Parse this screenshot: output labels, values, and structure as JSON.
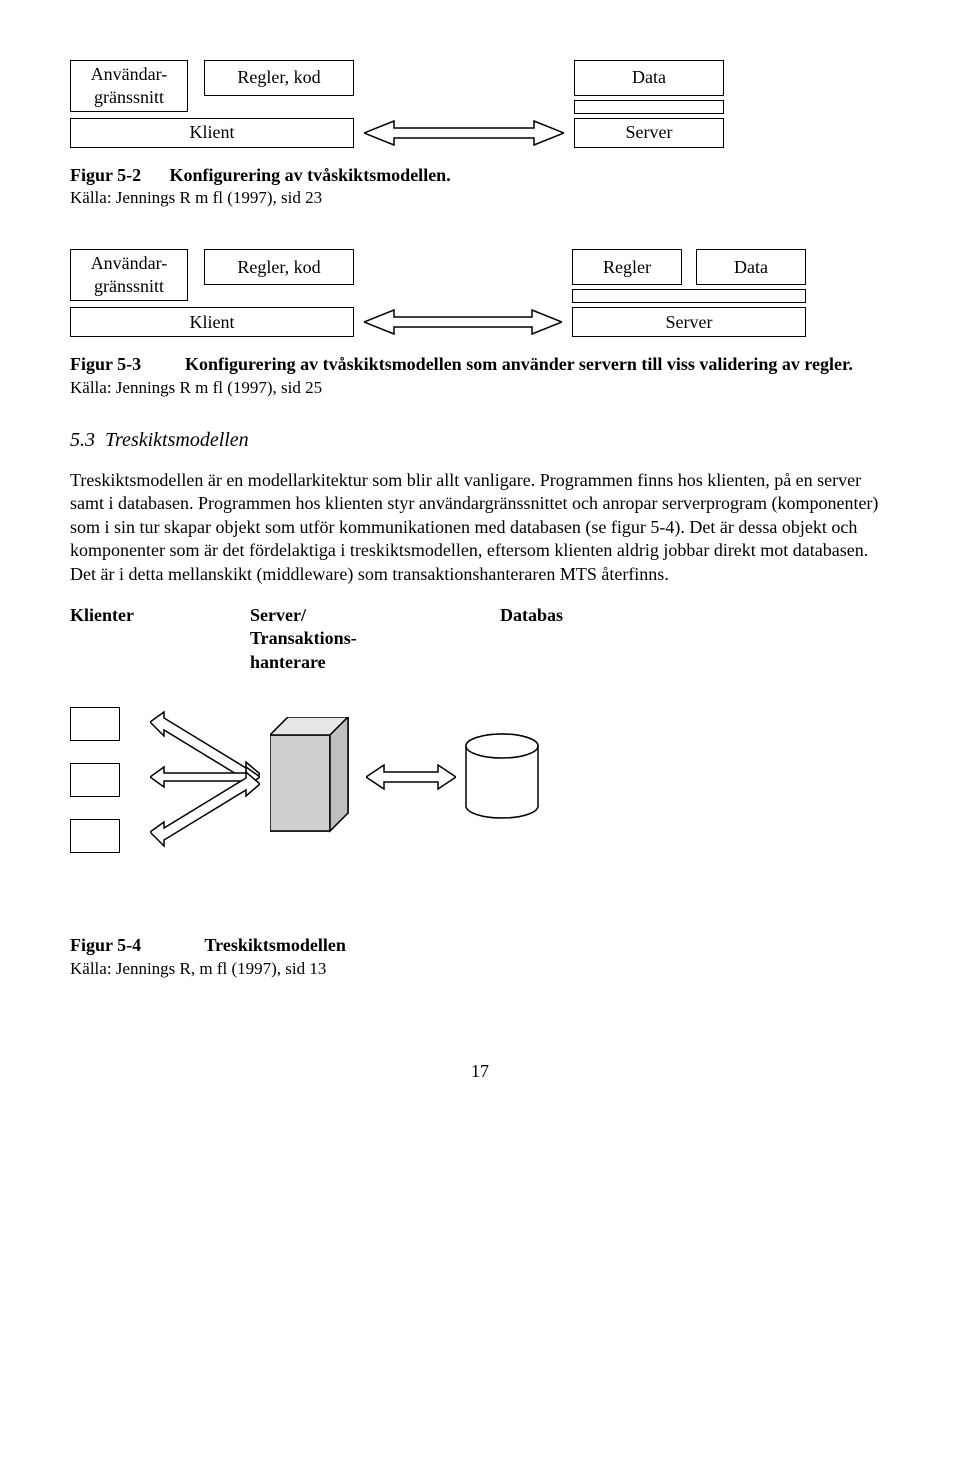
{
  "fig52": {
    "box_anvandar": "Användar-\ngränssnitt",
    "box_regler": "Regler, kod",
    "box_data": "Data",
    "box_klient": "Klient",
    "box_server": "Server",
    "label": "Figur 5-2",
    "title": "Konfigurering av tvåskiktsmodellen.",
    "source": "Källa: Jennings R m fl (1997), sid 23"
  },
  "fig53": {
    "box_anvandar": "Användar-\ngränssnitt",
    "box_reglerkod": "Regler, kod",
    "box_regler": "Regler",
    "box_data": "Data",
    "box_klient": "Klient",
    "box_server": "Server",
    "label": "Figur 5-3",
    "title": "Konfigurering av tvåskiktsmodellen som använder servern till viss validering av regler.",
    "source": "Källa: Jennings R m fl (1997), sid 25"
  },
  "section": {
    "num": "5.3",
    "title": "Treskiktsmodellen",
    "para": "Treskiktsmodellen är en modellarkitektur som blir allt vanligare. Programmen finns hos klienten, på en server samt i databasen. Programmen hos klienten styr användargränssnittet och anropar serverprogram (komponenter) som i sin tur skapar objekt som utför kommunikationen med databasen (se figur 5-4). Det är dessa objekt och komponenter som är det fördelaktiga i treskiktsmodellen, eftersom klienten aldrig jobbar direkt mot databasen. Det är i detta mellanskikt (middleware) som transaktionshanteraren MTS återfinns."
  },
  "fig54": {
    "h1": "Klienter",
    "h2": "Server/\nTransaktions-\nhanterare",
    "h3": "Databas",
    "label": "Figur 5-4",
    "title": "Treskiktsmodellen",
    "source": "Källa: Jennings R, m fl (1997), sid 13"
  },
  "page": "17"
}
